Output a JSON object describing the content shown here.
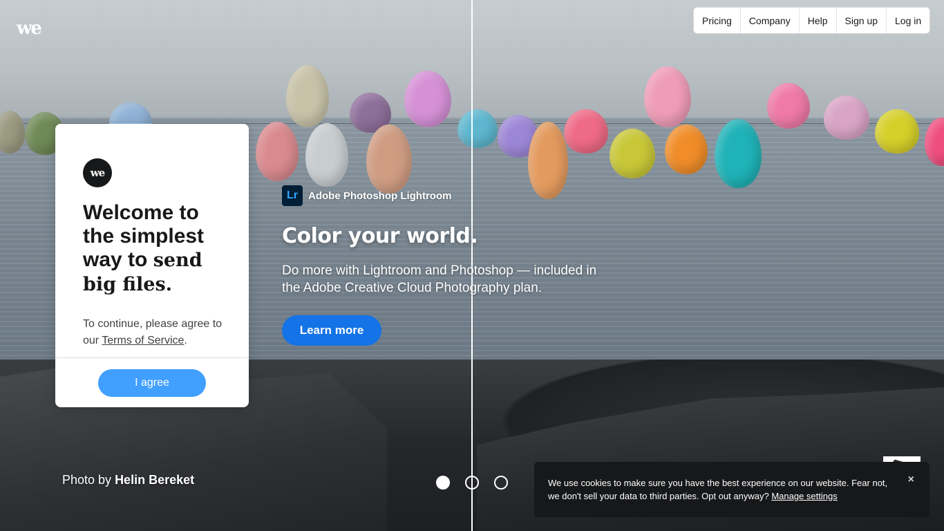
{
  "brand": {
    "logo_text": "we"
  },
  "nav": {
    "items": [
      {
        "label": "Pricing"
      },
      {
        "label": "Company"
      },
      {
        "label": "Help"
      },
      {
        "label": "Sign up"
      },
      {
        "label": "Log in"
      }
    ]
  },
  "welcome_card": {
    "logo_text": "we",
    "title_plain": "Welcome to the simplest way to ",
    "title_bold": "send big files.",
    "text_prefix": "To continue, please agree to our ",
    "terms_link": "Terms of Service",
    "text_suffix": ".",
    "agree_button": "I agree"
  },
  "ad": {
    "app_icon": "Lr",
    "app_name": "Adobe Photoshop Lightroom",
    "headline": "Color your world.",
    "body": "Do more with Lightroom and Photoshop — included in the Adobe Creative Cloud Photography plan.",
    "cta": "Learn more"
  },
  "credit": {
    "prefix": "Photo by ",
    "author": "Helin Bereket"
  },
  "carousel": {
    "count": 3,
    "active_index": 0
  },
  "cookie_banner": {
    "text": "We use cookies to make sure you have the best experience on our website. Fear not, we don't sell your data to third parties. Opt out anyway? ",
    "link": "Manage settings",
    "close": "×"
  },
  "colors": {
    "agree_button": "#409fff",
    "learn_more_button": "#1473e6",
    "lightroom_icon_bg": "#001e36",
    "lightroom_icon_fg": "#31a8ff",
    "cookie_bg": "#17181a"
  }
}
